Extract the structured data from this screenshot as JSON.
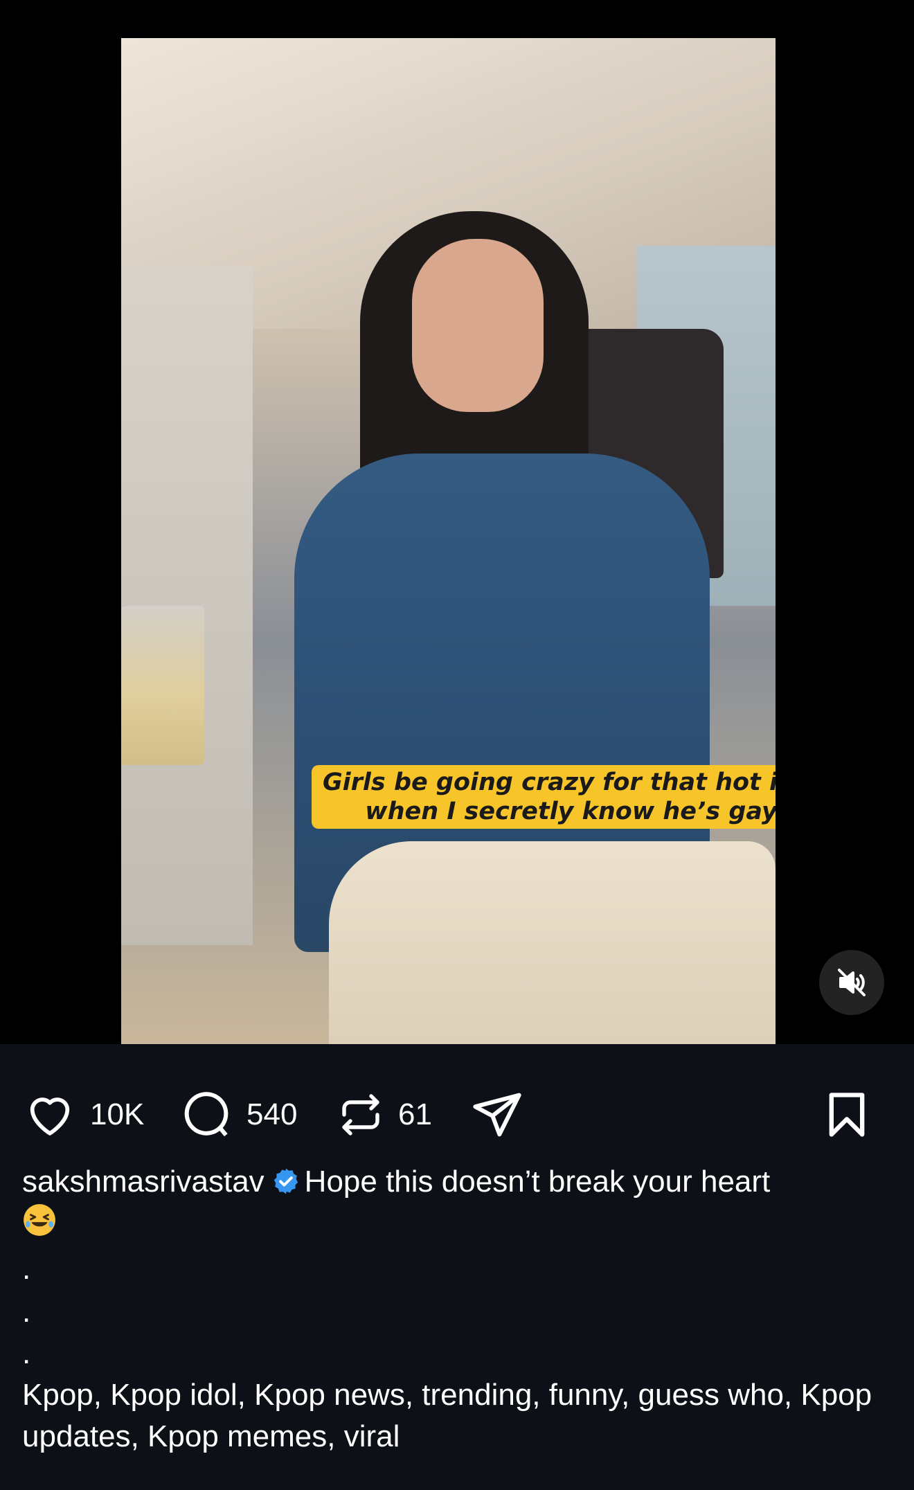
{
  "video": {
    "caption_overlay": "Girls be going crazy for that hot idol when I secretly know he’s gay",
    "mute_icon": "speaker-muted-icon"
  },
  "actions": {
    "like": {
      "icon": "heart-icon",
      "count": "10K"
    },
    "comment": {
      "icon": "comment-bubble-icon",
      "count": "540"
    },
    "repost": {
      "icon": "repost-icon",
      "count": "61"
    },
    "share": {
      "icon": "send-icon"
    },
    "save": {
      "icon": "bookmark-icon"
    }
  },
  "post": {
    "username": "sakshmasrivastav",
    "verified_icon": "verified-badge-icon",
    "caption": "Hope this doesn’t break your heart",
    "emoji": "🤣",
    "dots": [
      ".",
      ".",
      "."
    ],
    "tags": "Kpop, Kpop idol, Kpop news, trending, funny, guess who, Kpop updates, Kpop memes, viral"
  },
  "colors": {
    "background": "#000000",
    "panel": "#0d1117",
    "caption_highlight": "#f7c52a",
    "verified_blue": "#3797f0"
  }
}
